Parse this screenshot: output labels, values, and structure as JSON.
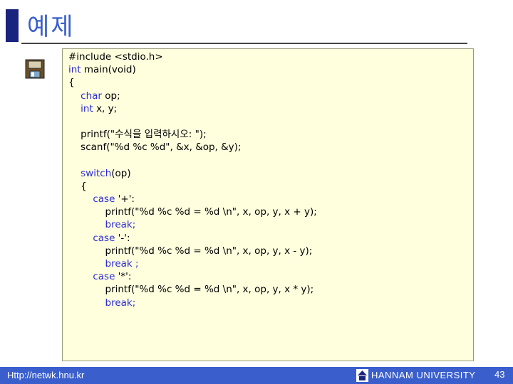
{
  "slide": {
    "title": "예제",
    "code_lines": [
      {
        "indent": 0,
        "parts": [
          {
            "t": "#include <stdio.h>",
            "k": false
          }
        ]
      },
      {
        "indent": 0,
        "parts": [
          {
            "t": "int",
            "k": true
          },
          {
            "t": " main(void)",
            "k": false
          }
        ]
      },
      {
        "indent": 0,
        "parts": [
          {
            "t": "{",
            "k": false
          }
        ]
      },
      {
        "indent": 1,
        "parts": [
          {
            "t": "char",
            "k": true
          },
          {
            "t": " op;",
            "k": false
          }
        ]
      },
      {
        "indent": 1,
        "parts": [
          {
            "t": "int",
            "k": true
          },
          {
            "t": " x, y;",
            "k": false
          }
        ]
      },
      {
        "indent": 0,
        "parts": [
          {
            "t": "",
            "k": false
          }
        ]
      },
      {
        "indent": 1,
        "parts": [
          {
            "t": "printf(\"수식을 입력하시오: \");",
            "k": false
          }
        ]
      },
      {
        "indent": 1,
        "parts": [
          {
            "t": "scanf(\"%d %c %d\", &x, &op, &y);",
            "k": false
          }
        ]
      },
      {
        "indent": 0,
        "parts": [
          {
            "t": "",
            "k": false
          }
        ]
      },
      {
        "indent": 1,
        "parts": [
          {
            "t": "switch",
            "k": true
          },
          {
            "t": "(op)",
            "k": false
          }
        ]
      },
      {
        "indent": 1,
        "parts": [
          {
            "t": "{",
            "k": false
          }
        ]
      },
      {
        "indent": 2,
        "parts": [
          {
            "t": "case",
            "k": true
          },
          {
            "t": " '+':",
            "k": false
          }
        ]
      },
      {
        "indent": 3,
        "parts": [
          {
            "t": "printf(\"%d %c %d = %d \\n\", x, op, y, x + y);",
            "k": false
          }
        ]
      },
      {
        "indent": 3,
        "parts": [
          {
            "t": "break;",
            "k": true
          }
        ]
      },
      {
        "indent": 2,
        "parts": [
          {
            "t": "case",
            "k": true
          },
          {
            "t": " '-':",
            "k": false
          }
        ]
      },
      {
        "indent": 3,
        "parts": [
          {
            "t": "printf(\"%d %c %d = %d \\n\", x, op, y, x - y);",
            "k": false
          }
        ]
      },
      {
        "indent": 3,
        "parts": [
          {
            "t": "break ;",
            "k": true
          }
        ]
      },
      {
        "indent": 2,
        "parts": [
          {
            "t": "case",
            "k": true
          },
          {
            "t": " '*':",
            "k": false
          }
        ]
      },
      {
        "indent": 3,
        "parts": [
          {
            "t": "printf(\"%d %c %d = %d \\n\", x, op, y, x * y);",
            "k": false
          }
        ]
      },
      {
        "indent": 3,
        "parts": [
          {
            "t": "break;",
            "k": true
          }
        ]
      }
    ],
    "icon": "floppy-disk-icon"
  },
  "footer": {
    "url": "Http://netwk.hnu.kr",
    "university": "HANNAM UNIVERSITY",
    "page_number": "43",
    "logo_icon": "university-logo-icon"
  },
  "colors": {
    "accent": "#3a5fcd",
    "keyword": "#2b2bd6",
    "code_background": "#ffffde",
    "title_bar": "#1a237e"
  }
}
